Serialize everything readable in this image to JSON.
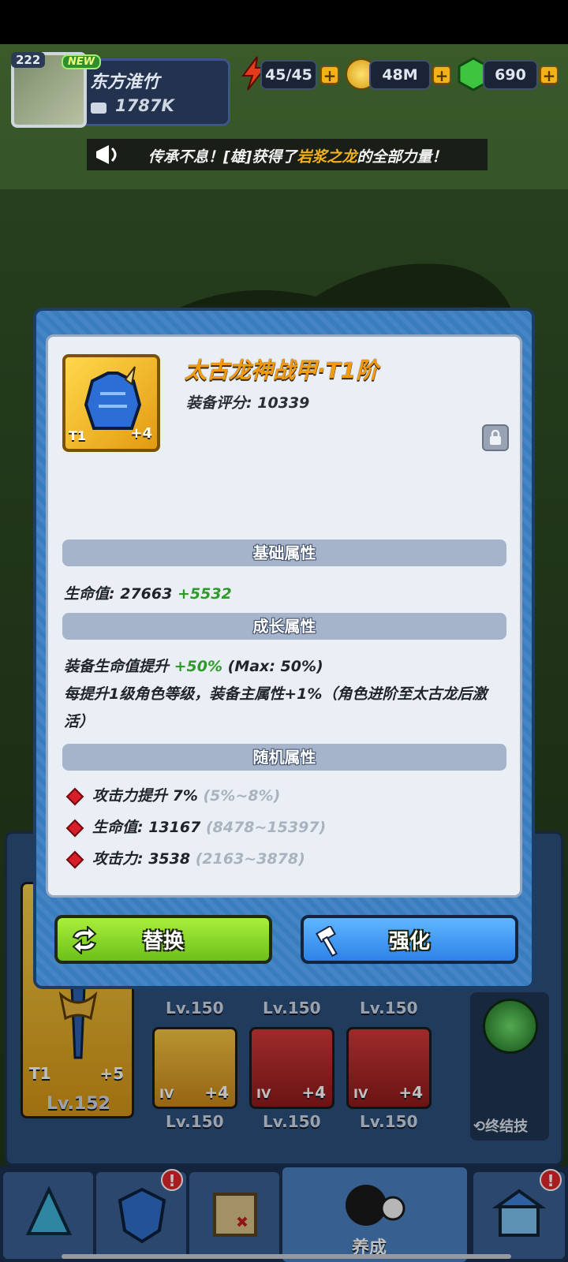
{
  "hud": {
    "player_level": "222",
    "new_badge": "NEW",
    "player_name": "东方淮竹",
    "power": "1787K",
    "stamina": "45/45",
    "gold": "48M",
    "gems": "690",
    "plus": "+"
  },
  "announcement": {
    "prefix": "传承不息！[雄]获得了",
    "highlight": "岩浆之龙",
    "suffix": "的全部力量！"
  },
  "item": {
    "title": "太古龙神战甲·T1阶",
    "score_label": "装备评分: ",
    "score": "10339",
    "tier": "T1",
    "plus_level": "+4"
  },
  "sections": {
    "basic": "基础属性",
    "growth": "成长属性",
    "random": "随机属性"
  },
  "basic_stats": {
    "label": "生命值: ",
    "value": "27663",
    "bonus": "+5532"
  },
  "growth_stats": {
    "line1_label": "装备生命值提升 ",
    "line1_bonus": "+50%",
    "line1_max": " (Max: 50%)",
    "line2": "每提升1级角色等级，装备主属性+1%（角色进阶至太古龙后激",
    "line3": "活）"
  },
  "random_stats": [
    {
      "label": "攻击力提升 7%",
      "range": "(5%~8%)"
    },
    {
      "label": "生命值: 13167",
      "range": "(8478~15397)"
    },
    {
      "label": "攻击力: 3538",
      "range": "(2163~3878)"
    }
  ],
  "buttons": {
    "replace": "替换",
    "enhance": "强化"
  },
  "equipment": {
    "main_level": "Lv.152",
    "main_tier": "T1",
    "main_plus": "+5",
    "top_row_levels": [
      "Lv.150",
      "Lv.150",
      "Lv.150"
    ],
    "bottom_row": [
      {
        "grade": "IV",
        "plus": "+4",
        "level": "Lv.150"
      },
      {
        "grade": "IV",
        "plus": "+4",
        "level": "Lv.150"
      },
      {
        "grade": "IV",
        "plus": "+4",
        "level": "Lv.150"
      }
    ],
    "ultimate_label": "终结技"
  },
  "nav": {
    "active_label": "养成",
    "badge": "!"
  },
  "colors": {
    "title_orange": "#f39b0f",
    "bonus_green": "#2f9a2a",
    "replace_green": "#8ed82a",
    "enhance_blue": "#3f9bf5"
  }
}
